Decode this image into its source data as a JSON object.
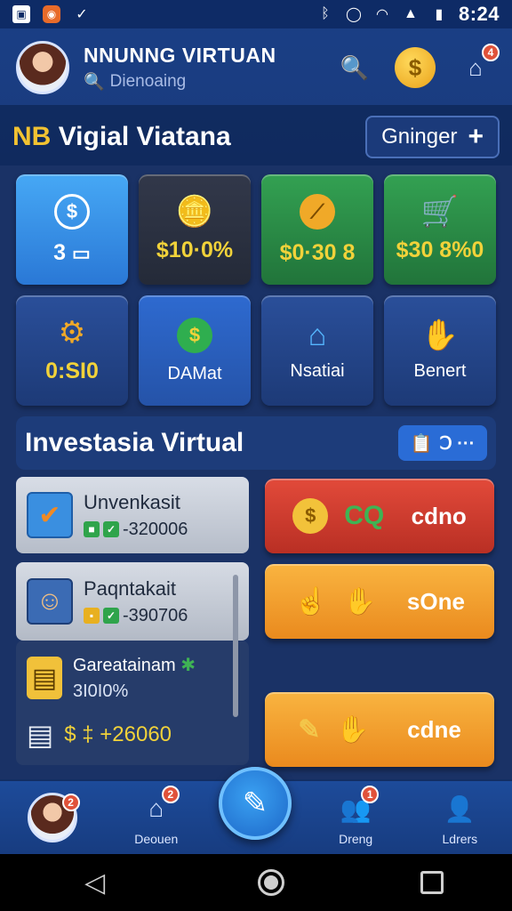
{
  "status_bar": {
    "time": "8:24"
  },
  "header": {
    "title": "NNUNNG VIRTUAN",
    "subtitle": "Dienoaing",
    "notification_count": "4"
  },
  "section": {
    "title_prefix": "NB",
    "title": "Vigial Viatana",
    "pill_label": "Gninger"
  },
  "tiles": [
    {
      "value": "3"
    },
    {
      "value": "$10·0%"
    },
    {
      "value": "$0·30 8"
    },
    {
      "value": "$30 8%0"
    },
    {
      "value": "0:SI0"
    },
    {
      "label": "DAMat"
    },
    {
      "label": "Nsatiai"
    },
    {
      "label": "Benert"
    }
  ],
  "investasia": {
    "title": "Investasia Virtual",
    "button_label": "Ↄ ···"
  },
  "list": [
    {
      "name": "Unvenkasit",
      "value": "-320006"
    },
    {
      "name": "Paqntakait",
      "value": "-390706"
    },
    {
      "name": "Gareatainam",
      "value": "3I0I0%"
    },
    {
      "value": "$ ‡ +26060"
    }
  ],
  "actions": [
    {
      "label": "cdno"
    },
    {
      "label": "sOne"
    },
    {
      "label": "cdne"
    }
  ],
  "bottom_nav": {
    "items": [
      {
        "label": ""
      },
      {
        "label": "Deouen",
        "badge": "2"
      },
      {
        "label": "Dreng",
        "badge": "1"
      },
      {
        "label": "Ldrers"
      }
    ]
  }
}
